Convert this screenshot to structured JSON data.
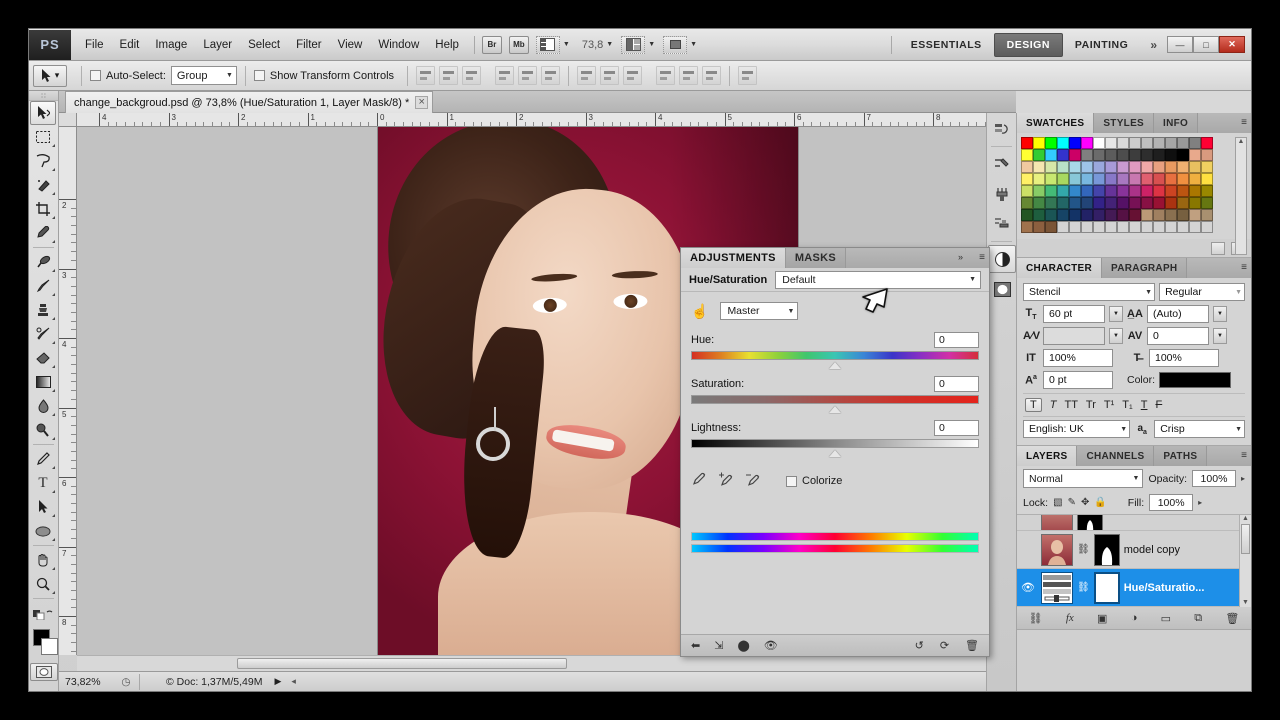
{
  "app": {
    "logo": "PS",
    "menus": [
      "File",
      "Edit",
      "Image",
      "Layer",
      "Select",
      "Filter",
      "View",
      "Window",
      "Help"
    ],
    "bridge_button": "Br",
    "minibridge_button": "Mb",
    "zoom_level_field": "73,8",
    "workspaces": [
      {
        "label": "ESSENTIALS",
        "active": false
      },
      {
        "label": "DESIGN",
        "active": true
      },
      {
        "label": "PAINTING",
        "active": false
      }
    ],
    "more_workspaces_icon": "chevron-double-right",
    "window_buttons": {
      "minimize": "—",
      "maximize": "□",
      "close": "✕"
    }
  },
  "options_bar": {
    "tool_icon": "move-tool",
    "auto_select_checked": false,
    "auto_select_label": "Auto-Select:",
    "auto_select_value": "Group",
    "show_transform_label": "Show Transform Controls",
    "show_transform_checked": false,
    "align_icons": [
      "align-left-edges",
      "align-horizontal-centers",
      "align-right-edges",
      "align-top-edges",
      "align-vertical-centers",
      "align-bottom-edges"
    ],
    "distribute_icons": [
      "distribute-top-edges",
      "distribute-vertical-centers",
      "distribute-bottom-edges",
      "distribute-left-edges",
      "distribute-horizontal-centers",
      "distribute-right-edges"
    ],
    "auto_align_icon": "auto-align-layers"
  },
  "toolbox": {
    "tools": [
      {
        "name": "move-tool",
        "glyph": "✥",
        "selected": true
      },
      {
        "name": "rectangular-marquee-tool",
        "glyph": "⬚",
        "selected": false
      },
      {
        "name": "lasso-tool",
        "glyph": "♒",
        "selected": false
      },
      {
        "name": "quick-selection-tool",
        "glyph": "✎",
        "selected": false
      },
      {
        "name": "crop-tool",
        "glyph": "✄",
        "selected": false
      },
      {
        "name": "eyedropper-tool",
        "glyph": "✒",
        "selected": false
      },
      {
        "name": "spot-healing-brush-tool",
        "glyph": "⊕",
        "selected": false
      },
      {
        "name": "brush-tool",
        "glyph": "✏",
        "selected": false
      },
      {
        "name": "clone-stamp-tool",
        "glyph": "⚑",
        "selected": false
      },
      {
        "name": "history-brush-tool",
        "glyph": "✐",
        "selected": false
      },
      {
        "name": "eraser-tool",
        "glyph": "⌫",
        "selected": false
      },
      {
        "name": "gradient-tool",
        "glyph": "▤",
        "selected": false
      },
      {
        "name": "blur-tool",
        "glyph": "●",
        "selected": false
      },
      {
        "name": "dodge-tool",
        "glyph": "⚲",
        "selected": false
      },
      {
        "name": "pen-tool",
        "glyph": "✑",
        "selected": false
      },
      {
        "name": "horizontal-type-tool",
        "glyph": "T",
        "selected": false
      },
      {
        "name": "path-selection-tool",
        "glyph": "➤",
        "selected": false
      },
      {
        "name": "ellipse-tool",
        "glyph": "⬭",
        "selected": false
      },
      {
        "name": "hand-tool",
        "glyph": "✋",
        "selected": false
      },
      {
        "name": "zoom-tool",
        "glyph": "⚲",
        "selected": false
      }
    ],
    "foreground_color": "#000000",
    "background_color": "#ffffff",
    "quick_mask_icon": "quick-mask-mode"
  },
  "document": {
    "tab_title": "change_backgroud.psd @ 73,8% (Hue/Saturation 1, Layer Mask/8) *",
    "close_icon": "×",
    "ruler_h_labels": [
      "4",
      "3",
      "2",
      "1",
      "0",
      "1",
      "2",
      "3",
      "4",
      "5",
      "6",
      "7",
      "8"
    ],
    "ruler_v_labels": [
      "2",
      "3",
      "4",
      "5",
      "6",
      "7",
      "8"
    ]
  },
  "status_bar": {
    "zoom": "73,82%",
    "clock_icon": "clock-icon",
    "doc_info": "© Doc: 1,37M/5,49M",
    "arrow": "▶"
  },
  "icon_rail": [
    {
      "name": "history-panel-icon",
      "glyph": "↺",
      "selected": false
    },
    {
      "name": "tool-presets-icon",
      "glyph": "⚒",
      "selected": false
    },
    {
      "name": "brush-presets-icon",
      "glyph": "⚘",
      "selected": false
    },
    {
      "name": "clone-source-icon",
      "glyph": "⎙",
      "selected": false
    },
    {
      "name": "adjustments-panel-icon",
      "glyph": "◑",
      "selected": true
    },
    {
      "name": "masks-panel-icon",
      "glyph": "○",
      "selected": false
    }
  ],
  "swatches_panel": {
    "tabs": [
      {
        "label": "SWATCHES",
        "active": true
      },
      {
        "label": "STYLES",
        "active": false
      },
      {
        "label": "INFO",
        "active": false
      }
    ],
    "menu_icon": "panel-menu-icon",
    "colors": [
      "#ff0000",
      "#ffff00",
      "#00ff00",
      "#00ffff",
      "#0000ff",
      "#ff00ff",
      "#ffffff",
      "#e6e6e6",
      "#d9d9d9",
      "#cccccc",
      "#bfbfbf",
      "#b3b3b3",
      "#a6a6a6",
      "#999999",
      "#808080",
      "#ff0033",
      "#ffff33",
      "#33cc33",
      "#33ccff",
      "#3333cc",
      "#cc0066",
      "#808080",
      "#6b6b6b",
      "#5c5c5c",
      "#4d4d4d",
      "#3d3d3d",
      "#2e2e2e",
      "#1f1f1f",
      "#0f0f0f",
      "#000000",
      "#e8a98c",
      "#d99a7f",
      "#f0c9a0",
      "#f5e6b0",
      "#d6e8a8",
      "#b8e0c8",
      "#a8d8e8",
      "#9ec4e8",
      "#9aa8dd",
      "#a89ad8",
      "#c89ad0",
      "#e09ac0",
      "#f0a8a8",
      "#e8a080",
      "#e89a60",
      "#f0b070",
      "#e8c060",
      "#f0d060",
      "#fff066",
      "#e8f080",
      "#c8e870",
      "#a8d860",
      "#88c8d8",
      "#78b8e0",
      "#7898d8",
      "#8878c8",
      "#a878c0",
      "#c878b0",
      "#e06070",
      "#d85050",
      "#e87040",
      "#f09040",
      "#f0b040",
      "#ffe040",
      "#cce066",
      "#88cc66",
      "#44bb77",
      "#33a8aa",
      "#3388cc",
      "#3366bb",
      "#4444aa",
      "#663399",
      "#883399",
      "#aa3388",
      "#cc2266",
      "#dd3344",
      "#cc4422",
      "#bb5511",
      "#aa7700",
      "#998800",
      "#668833",
      "#448844",
      "#337755",
      "#226666",
      "#225588",
      "#224477",
      "#332288",
      "#442277",
      "#551166",
      "#771155",
      "#881144",
      "#991133",
      "#aa3311",
      "#996611",
      "#887700",
      "#667711",
      "#225522",
      "#1e5e3e",
      "#1a5555",
      "#164466",
      "#133366",
      "#222266",
      "#331f66",
      "#441a55",
      "#551144",
      "#661133",
      "#bb9977",
      "#a08060",
      "#8a7050",
      "#776040",
      "#c0a080",
      "#a89070",
      "#a0724d",
      "#8c5f3f",
      "#7a5436",
      "#d4d4d4",
      "#d4d4d4",
      "#d4d4d4",
      "#d4d4d4",
      "#d4d4d4",
      "#d4d4d4",
      "#d4d4d4",
      "#d4d4d4",
      "#d4d4d4",
      "#d4d4d4",
      "#d4d4d4",
      "#d4d4d4",
      "#d4d4d4"
    ]
  },
  "character_panel": {
    "tabs": [
      {
        "label": "CHARACTER",
        "active": true
      },
      {
        "label": "PARAGRAPH",
        "active": false
      }
    ],
    "menu_icon": "panel-menu-icon",
    "font_family": "Stencil",
    "font_style": "Regular",
    "font_size_icon": "font-size-icon",
    "font_size": "60 pt",
    "leading_icon": "leading-icon",
    "leading": "(Auto)",
    "kerning_icon": "kerning-icon",
    "kerning": "",
    "tracking_icon": "tracking-icon",
    "tracking": "0",
    "vertical_scale_icon": "vertical-scale-icon",
    "vertical_scale": "100%",
    "horizontal_scale_icon": "horizontal-scale-icon",
    "horizontal_scale": "100%",
    "baseline_icon": "baseline-shift-icon",
    "baseline_shift": "0 pt",
    "color_label": "Color:",
    "color_value": "#000000",
    "style_buttons": [
      "T",
      "T",
      "TT",
      "Tr",
      "T¹",
      "T₁",
      "T",
      "F"
    ],
    "language": "English: UK",
    "antialias_icon": "anti-alias-icon",
    "antialias": "Crisp"
  },
  "layers_panel": {
    "tabs": [
      {
        "label": "LAYERS",
        "active": true
      },
      {
        "label": "CHANNELS",
        "active": false
      },
      {
        "label": "PATHS",
        "active": false
      }
    ],
    "menu_icon": "panel-menu-icon",
    "blend_mode": "Normal",
    "opacity_label": "Opacity:",
    "opacity_value": "100%",
    "lock_label": "Lock:",
    "lock_icons": [
      "lock-transparent-pixels",
      "lock-image-pixels",
      "lock-position",
      "lock-all"
    ],
    "fill_label": "Fill:",
    "fill_value": "100%",
    "layers": [
      {
        "name": "",
        "visible": false,
        "selected": false,
        "partial": true
      },
      {
        "name": "model copy",
        "visible": false,
        "selected": false,
        "partial": false
      },
      {
        "name": "Hue/Saturatio...",
        "visible": true,
        "selected": true,
        "partial": false
      }
    ],
    "footer_icons": [
      "link-layers",
      "add-layer-style",
      "add-layer-mask",
      "new-adjustment-layer",
      "new-group",
      "new-layer",
      "delete-layer"
    ]
  },
  "adjustments_panel": {
    "tabs": [
      {
        "label": "ADJUSTMENTS",
        "active": true
      },
      {
        "label": "MASKS",
        "active": false
      }
    ],
    "collapse_icon": "collapse-arrows-icon",
    "menu_icon": "panel-menu-icon",
    "title": "Hue/Saturation",
    "preset": "Default",
    "target_adjust_icon": "targeted-adjustment-icon",
    "channel": "Master",
    "sliders": [
      {
        "label": "Hue:",
        "value": "0",
        "track": "hue"
      },
      {
        "label": "Saturation:",
        "value": "0",
        "track": "sat"
      },
      {
        "label": "Lightness:",
        "value": "0",
        "track": "light"
      }
    ],
    "eyedropper_icons": [
      "eyedropper-icon",
      "eyedropper-add-icon",
      "eyedropper-subtract-icon"
    ],
    "colorize_label": "Colorize",
    "colorize_checked": false,
    "footer_icons_left": [
      "return-to-adjustment-list",
      "clip-to-layer",
      "view-previous-state",
      "toggle-layer-visibility"
    ],
    "footer_icons_right": [
      "reset-to-previous",
      "reset-adjustment",
      "delete-adjustment-layer"
    ]
  }
}
